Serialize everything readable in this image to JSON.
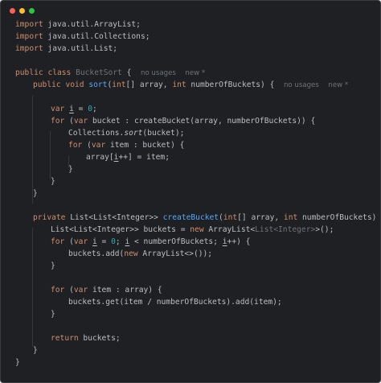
{
  "window_controls": [
    "close",
    "minimize",
    "maximize"
  ],
  "colors": {
    "background": "#1f2023",
    "keyword": "#cf8e6d",
    "function": "#56a8f5",
    "number": "#2aacb8",
    "default_text": "#bcbec4",
    "hint": "#6f737a"
  },
  "language": "java",
  "code": {
    "l1": {
      "kw": "import",
      "rest": " java.util.ArrayList;"
    },
    "l2": {
      "kw": "import",
      "rest": " java.util.Collections;"
    },
    "l3": {
      "kw": "import",
      "rest": " java.util.List;"
    },
    "l5": {
      "kw1": "public",
      "kw2": "class",
      "name": "BucketSort",
      "brace": "{",
      "hint1": "no usages",
      "hint2": "new *"
    },
    "l6": {
      "kw1": "public",
      "kw2": "void",
      "fn": "sort",
      "p1": "(",
      "kw3": "int",
      "p2": "[] array, ",
      "kw4": "int",
      "p3": " numberOfBuckets) {",
      "hint1": "no usages",
      "hint2": "new *"
    },
    "l8": {
      "kw": "var",
      "sp": " ",
      "var": "i",
      "eq": " = ",
      "num": "0",
      "end": ";"
    },
    "l9": {
      "kw1": "for",
      "a": " (",
      "kw2": "var",
      "b": " bucket : createBucket(array, numberOfBuckets)) {"
    },
    "l10": {
      "a": "Collections.",
      "m": "sort",
      "b": "(bucket);"
    },
    "l11": {
      "kw1": "for",
      "a": " (",
      "kw2": "var",
      "b": " item : bucket) {"
    },
    "l12": {
      "a": "array[",
      "var": "i",
      "b": "++] = item;"
    },
    "l13": {
      "text": "}"
    },
    "l14": {
      "text": "}"
    },
    "l15": {
      "text": "}"
    },
    "l17": {
      "kw": "private",
      "a": " List<List<Integer>> ",
      "fn": "createBucket",
      "p1": "(",
      "kw2": "int",
      "p2": "[] array, ",
      "kw3": "int",
      "p3": " numberOfBuckets) {"
    },
    "l18": {
      "a": "List<List<Integer>> buckets = ",
      "kw": "new",
      "b": " ArrayList<",
      "grey": "List<Integer>",
      "c": ">();"
    },
    "l19": {
      "kw1": "for",
      "a": " (",
      "kw2": "var",
      "sp": " ",
      "var1": "i",
      "eq": " = ",
      "num": "0",
      "b": "; ",
      "var2": "i",
      "c": " < numberOfBuckets; ",
      "var3": "i",
      "d": "++) {"
    },
    "l20": {
      "a": "buckets.add(",
      "kw": "new",
      "b": " ArrayList<>());"
    },
    "l21": {
      "text": "}"
    },
    "l23": {
      "kw1": "for",
      "a": " (",
      "kw2": "var",
      "b": " item : array) {"
    },
    "l24": {
      "text": "buckets.get(item / numberOfBuckets).add(item);"
    },
    "l25": {
      "text": "}"
    },
    "l27": {
      "kw": "return",
      "b": " buckets;"
    },
    "l28": {
      "text": "}"
    },
    "l29": {
      "text": "}"
    }
  }
}
